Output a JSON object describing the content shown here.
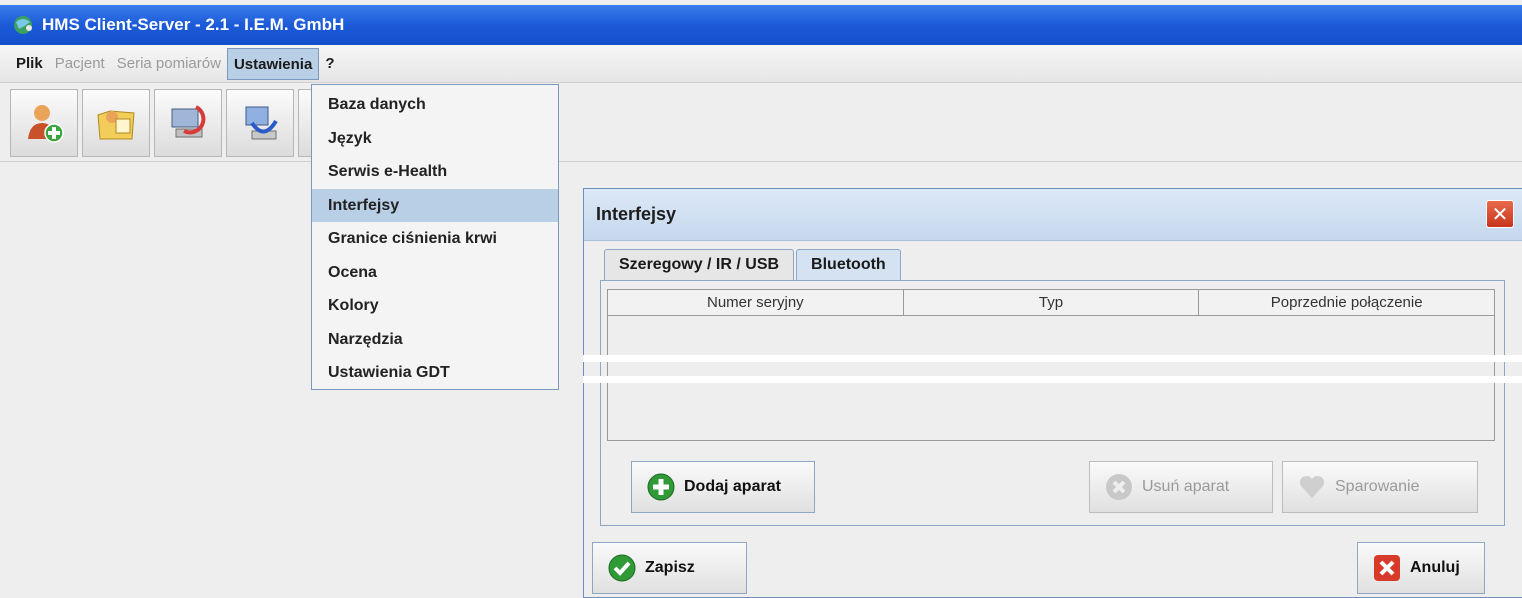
{
  "window": {
    "title": "HMS Client-Server - 2.1 - I.E.M. GmbH"
  },
  "menubar": {
    "items": [
      {
        "label": "Plik",
        "enabled": true
      },
      {
        "label": "Pacjent",
        "enabled": false
      },
      {
        "label": "Seria pomiarów",
        "enabled": false
      },
      {
        "label": "Ustawienia",
        "enabled": true,
        "active": true
      },
      {
        "label": "?",
        "enabled": true
      }
    ]
  },
  "toolbar": {
    "buttons": [
      {
        "icon": "add-patient-icon"
      },
      {
        "icon": "open-folder-icon"
      },
      {
        "icon": "transfer-device-icon"
      },
      {
        "icon": "sync-computer-icon"
      }
    ]
  },
  "settings_menu": {
    "items": [
      "Baza danych",
      "Język",
      "Serwis e-Health",
      "Interfejsy",
      "Granice ciśnienia krwi",
      "Ocena",
      "Kolory",
      "Narzędzia",
      "Ustawienia GDT"
    ],
    "highlighted": "Interfejsy"
  },
  "dialog": {
    "title": "Interfejsy",
    "tabs": [
      "Szeregowy / IR / USB",
      "Bluetooth"
    ],
    "selected_tab": "Bluetooth",
    "table": {
      "columns": [
        "Numer seryjny",
        "Typ",
        "Poprzednie połączenie"
      ],
      "rows": []
    },
    "buttons": {
      "add": "Dodaj aparat",
      "remove": "Usuń aparat",
      "pair": "Sparowanie",
      "save": "Zapisz",
      "cancel": "Anuluj"
    },
    "close_symbol": "✕"
  },
  "colors": {
    "titlebar": "#1c5ad8",
    "menu_highlight": "#b8cfe5",
    "dialog_title": "#c6d8ee",
    "close_button": "#c8351e"
  }
}
